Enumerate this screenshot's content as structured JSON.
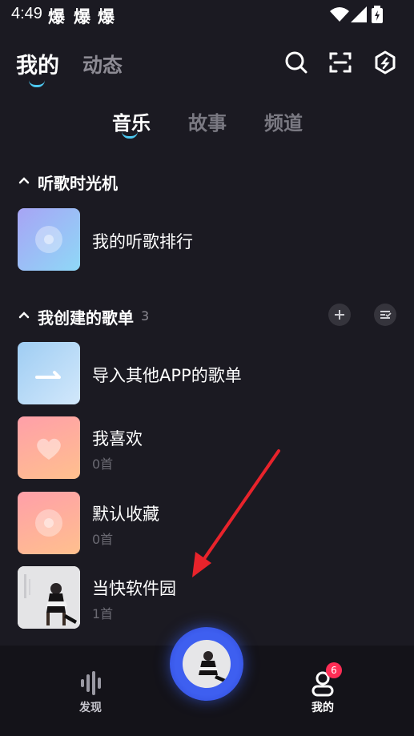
{
  "status_bar": {
    "time": "4:49",
    "notifications": [
      "爆",
      "爆",
      "爆"
    ]
  },
  "header": {
    "tabs": [
      {
        "label": "我的",
        "active": true
      },
      {
        "label": "动态",
        "active": false
      }
    ],
    "icons": [
      "search-icon",
      "scan-icon",
      "hexagon-settings-icon"
    ]
  },
  "sub_tabs": [
    {
      "label": "音乐",
      "active": true
    },
    {
      "label": "故事",
      "active": false
    },
    {
      "label": "频道",
      "active": false
    }
  ],
  "time_machine": {
    "title": "听歌时光机",
    "item": {
      "title": "我的听歌排行"
    }
  },
  "playlists": {
    "title": "我创建的歌单",
    "count": "3",
    "items": [
      {
        "title": "导入其他APP的歌单",
        "sub": ""
      },
      {
        "title": "我喜欢",
        "sub": "0首"
      },
      {
        "title": "默认收藏",
        "sub": "0首"
      },
      {
        "title": "当快软件园",
        "sub": "1首"
      }
    ]
  },
  "bottom_nav": {
    "discover": "发现",
    "mine": "我的",
    "mine_badge": "6"
  },
  "colors": {
    "background": "#1b1a22",
    "accent": "#4dc8f0",
    "badge": "#ff2d55",
    "annotation_arrow": "#e8232b"
  }
}
